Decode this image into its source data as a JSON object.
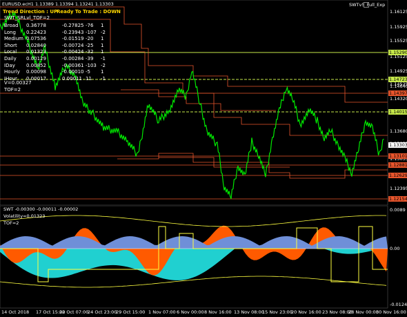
{
  "chart_header": {
    "symbol_info": "EURUSD.ecH1  1.13389 1.13394 1.13241 1.13303",
    "trend_direction": "Trend Direction : UP",
    "ready_to_trade": "Ready To Trade : DOWN",
    "indicator_name": "SWT_SRLvl_TOF=2",
    "corner_label": "SWTv5_Full_Exp",
    "v_value": "V=0.00327",
    "tof": "TOF=2"
  },
  "levels_table": {
    "rows": [
      {
        "name": "Broad",
        "c1": "0.36778",
        "c2": "-0.27825",
        "c3": "-76",
        "c4": "1"
      },
      {
        "name": "Long",
        "c1": "0.22423",
        "c2": "-0.23943",
        "c3": "-107",
        "c4": "-2"
      },
      {
        "name": "Medium",
        "c1": "0.07536",
        "c2": "-0.01519",
        "c3": "-20",
        "c4": "1"
      },
      {
        "name": "Short",
        "c1": "0.02840",
        "c2": "-0.00724",
        "c3": "-25",
        "c4": "1"
      },
      {
        "name": "Local",
        "c1": "0.01323",
        "c2": "-0.00424",
        "c3": "-32",
        "c4": "1"
      },
      {
        "name": "Daily",
        "c1": "0.00129",
        "c2": "-0.00284",
        "c3": "-39",
        "c4": "-1"
      },
      {
        "name": "IDay",
        "c1": "0.00852",
        "c2": "-0.00361",
        "c3": "-103",
        "c4": "-2"
      },
      {
        "name": "Hourly",
        "c1": "0.00098",
        "c2": "-0.00010",
        "c3": "-5",
        "c4": "1"
      },
      {
        "name": "IHour",
        "c1": "0.00017",
        "c2": "0.00011",
        "c3": "11",
        "c4": "-1"
      }
    ]
  },
  "price_axis": {
    "labels": [
      "1.16125",
      "1.15925",
      "1.15525",
      "1.15125",
      "1.14925",
      "1.14525",
      "1.14320",
      "1.13920",
      "1.13680",
      "1.13355",
      "1.13035",
      "1.12395",
      "1.12215"
    ],
    "tags": [
      {
        "text": "1.15290",
        "color": "#c6e84a"
      },
      {
        "text": "1.14723",
        "color": "#c6e84a"
      },
      {
        "text": "1.14397",
        "color": "#e8552c"
      },
      {
        "text": "1.14015",
        "color": "#c6e84a"
      },
      {
        "text": "1.13303",
        "color": "#ffffff"
      },
      {
        "text": "1.13101",
        "color": "#e8552c"
      },
      {
        "text": "1.12881",
        "color": "#e8552c"
      },
      {
        "text": "1.12629",
        "color": "#e8552c"
      },
      {
        "text": "1.12154",
        "color": "#e8552c"
      }
    ],
    "extra": [
      "1.14640",
      "1.13835"
    ]
  },
  "sub_window": {
    "title": "SWT -0.00300 -0.00011 -0.00002",
    "volatility": "Volatility=0.01323",
    "tof": "TOF=2",
    "axis_labels": [
      "0.0089",
      "0.00",
      "-0.01246"
    ]
  },
  "time_axis": {
    "labels": [
      "14 Oct 2018",
      "17 Oct 15:00",
      "22 Oct 07:00",
      "24 Oct 23:00",
      "29 Oct 15:00",
      "1 Nov 07:00",
      "6 Nov 00:00",
      "8 Nov 16:00",
      "13 Nov 08:00",
      "15 Nov 23:00",
      "20 Nov 16:00",
      "23 Nov 08:00",
      "28 Nov 00:00",
      "30 Nov 16:00"
    ]
  },
  "colors": {
    "price": "#00e800",
    "support": "#c6e84a",
    "resistance": "#e8552c",
    "osc_orange": "#ff5a00",
    "osc_blue": "#6f8fd8",
    "osc_cyan": "#20d0d0",
    "osc_yellow": "#ffff40"
  }
}
